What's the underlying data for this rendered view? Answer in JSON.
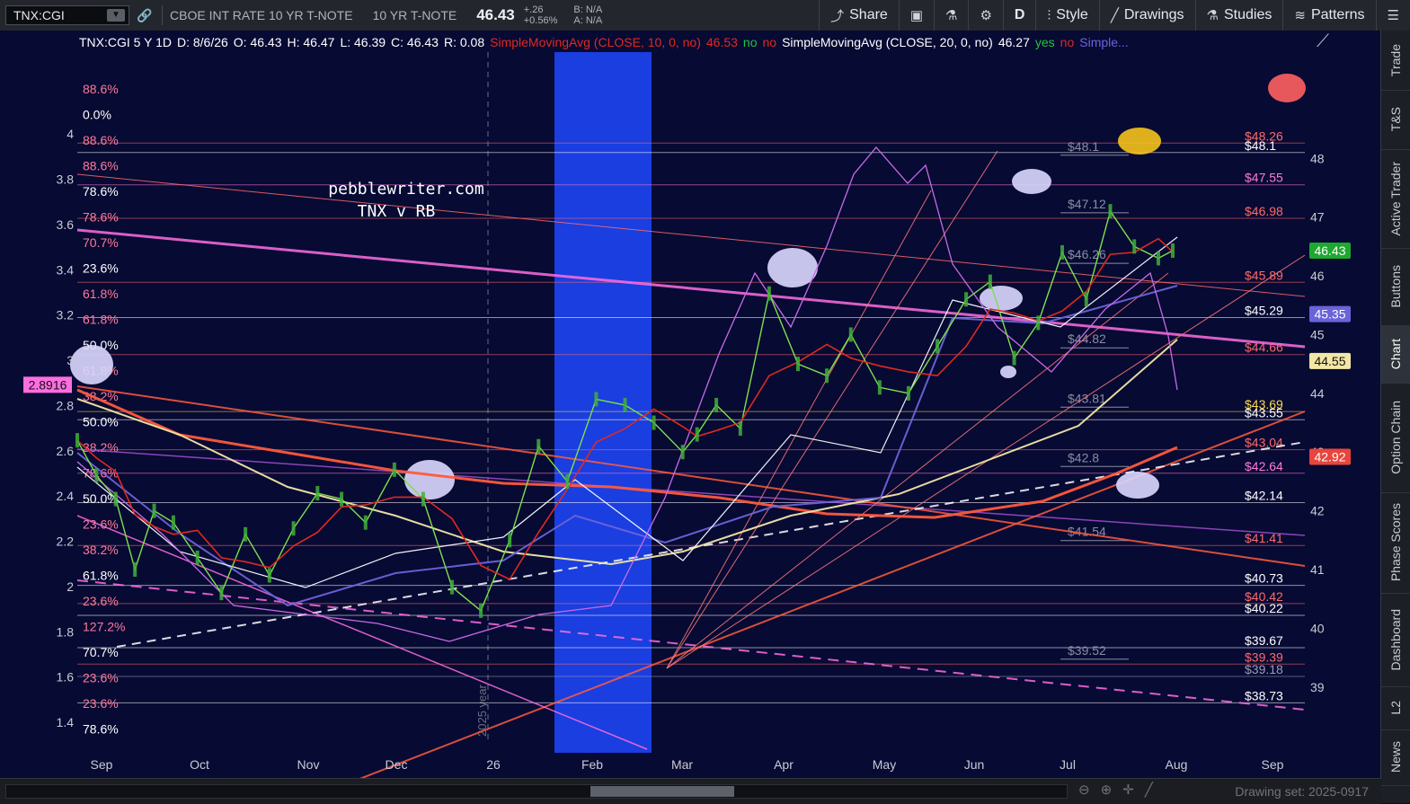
{
  "toolbar": {
    "symbol": "TNX:CGI",
    "description": "CBOE INT RATE 10 YR T-NOTE",
    "short_name": "10 YR T-NOTE",
    "price": "46.43",
    "change": "+.26",
    "change_pct": "+0.56%",
    "bid": "B: N/A",
    "ask": "A: N/A",
    "share": "Share",
    "aggregation": "D",
    "style": "Style",
    "drawings": "Drawings",
    "studies": "Studies",
    "patterns": "Patterns"
  },
  "status_line": {
    "symbol": "TNX:CGI 5 Y 1D",
    "date": "D: 8/6/26",
    "open": "O: 46.43",
    "high": "H: 46.47",
    "low": "L: 46.39",
    "close": "C: 46.43",
    "range": "R: 0.08",
    "sma10": "SimpleMovingAvg (CLOSE, 10, 0, no)",
    "sma10_value": "46.53",
    "sma10_no1": "no",
    "sma10_no2": "no",
    "sma20": "SimpleMovingAvg (CLOSE, 20, 0, no)",
    "sma20_value": "46.27",
    "sma20_yes": "yes",
    "sma20_no": "no",
    "more": "Simple..."
  },
  "chart_text": {
    "watermark_site": "pebblewriter.com",
    "watermark_title": "TNX v RB",
    "year_divider": "2025 year"
  },
  "chart_data": {
    "type": "line",
    "x_labels": [
      "Sep",
      "Oct",
      "Nov",
      "Dec",
      "26",
      "Feb",
      "Mar",
      "Apr",
      "May",
      "Jun",
      "Jul",
      "Aug",
      "Sep"
    ],
    "left_axis_ticks": [
      "4",
      "3.8",
      "3.6",
      "3.4",
      "3.2",
      "3",
      "2.8",
      "2.6",
      "2.4",
      "2.2",
      "2",
      "1.8",
      "1.6",
      "1.4"
    ],
    "right_axis_ticks": [
      "48",
      "47",
      "46",
      "45",
      "44",
      "43",
      "42",
      "41",
      "40",
      "39"
    ],
    "right_ylim": [
      38.4,
      48.8
    ],
    "left_ylim": [
      1.4,
      4.1
    ],
    "left_marker": "2.8916",
    "price_series": {
      "name": "TNX:CGI",
      "x": [
        0,
        8,
        16,
        24,
        32,
        40,
        50,
        60,
        70,
        80,
        90,
        100,
        110,
        120,
        132,
        144,
        156,
        168,
        180,
        192,
        204,
        216,
        228,
        240,
        252,
        258,
        266,
        276,
        288,
        300,
        312,
        322,
        334,
        346,
        358,
        370,
        380,
        390,
        400,
        410,
        420,
        430,
        440,
        450,
        456
      ],
      "y": [
        43.2,
        42.6,
        42.2,
        41.0,
        42.0,
        41.8,
        41.2,
        40.6,
        41.6,
        40.9,
        41.7,
        42.3,
        42.2,
        41.8,
        42.7,
        42.2,
        40.7,
        40.3,
        41.5,
        43.1,
        42.5,
        43.9,
        43.8,
        43.5,
        43.0,
        43.3,
        43.8,
        43.4,
        45.7,
        44.5,
        44.3,
        45.0,
        44.1,
        44.0,
        44.8,
        45.6,
        45.9,
        44.6,
        45.2,
        46.4,
        45.6,
        47.1,
        46.5,
        46.3,
        46.43
      ]
    },
    "sma10": {
      "name": "SimpleMovingAvg (CLOSE, 10, 0, no)",
      "value": "46.53"
    },
    "sma20": {
      "name": "SimpleMovingAvg (CLOSE, 20, 0, no)",
      "value": "46.27"
    },
    "fib_levels_right": [
      "$48.26",
      "$48.1",
      "$47.55",
      "$46.98",
      "$45.89",
      "$45.29",
      "$44.66",
      "$43.69",
      "$43.55",
      "$43.04",
      "$42.64",
      "$42.14",
      "$41.41",
      "$40.73",
      "$40.42",
      "$40.22",
      "$39.67",
      "$39.39",
      "$39.18",
      "$38.73"
    ],
    "fib_values": [
      48.26,
      48.1,
      47.55,
      46.98,
      45.89,
      45.29,
      44.66,
      43.69,
      43.55,
      43.04,
      42.64,
      42.14,
      41.41,
      40.73,
      40.42,
      40.22,
      39.67,
      39.39,
      39.18,
      38.73
    ],
    "fib_colors": [
      "#ff6a6a",
      "#ffffff",
      "#ff7ad9",
      "#ff6a6a",
      "#ff6a6a",
      "#ffffff",
      "#ff6a6a",
      "#ffd84a",
      "#ffffff",
      "#ff6a6a",
      "#ff7ad9",
      "#ffffff",
      "#ff6a6a",
      "#ffffff",
      "#ff6a6a",
      "#ffffff",
      "#ffffff",
      "#ff6a6a",
      "#9a9db5",
      "#ffffff"
    ],
    "fib_pct_left": [
      "88.6%",
      "0.0%",
      "88.6%",
      "88.6%",
      "78.6%",
      "78.6%",
      "70.7%",
      "23.6%",
      "61.8%",
      "61.8%",
      "50.0%",
      "61.8%",
      "38.2%",
      "50.0%",
      "38.2%",
      "78.6%",
      "50.0%",
      "23.6%",
      "38.2%",
      "61.8%",
      "23.6%",
      "127.2%",
      "70.7%",
      "23.6%",
      "23.6%",
      "78.6%"
    ],
    "grey_levels": [
      "$48.1",
      "$47.12",
      "$46.26",
      "$44.82",
      "$43.81",
      "$42.8",
      "$41.54",
      "$39.52"
    ],
    "right_badges": [
      {
        "label": "46.43",
        "value": 46.43,
        "color": "#1fa830"
      },
      {
        "label": "45.35",
        "value": 45.35,
        "color": "#6b63d9"
      },
      {
        "label": "44.55",
        "value": 44.55,
        "color": "#f3e7a5"
      },
      {
        "label": "42.92",
        "value": 42.92,
        "color": "#e8453c"
      }
    ]
  },
  "sidebar": {
    "tabs": [
      "Trade",
      "T&S",
      "Active Trader",
      "Buttons",
      "Chart",
      "Option Chain",
      "Phase Scores",
      "Dashboard",
      "L2",
      "News"
    ],
    "active": "Chart"
  },
  "bottom": {
    "drawing_set": "Drawing set: 2025-0917"
  },
  "colors": {
    "background": "#070a33",
    "highlight": "#1a3ee0",
    "sma_red": "#e0291f",
    "sma_white": "#ffffff",
    "sma_blue": "#6b63d9",
    "sma_yellow": "#f3e7a5",
    "sma_orange": "#ff5a3c",
    "rb_line": "#c86be6"
  }
}
